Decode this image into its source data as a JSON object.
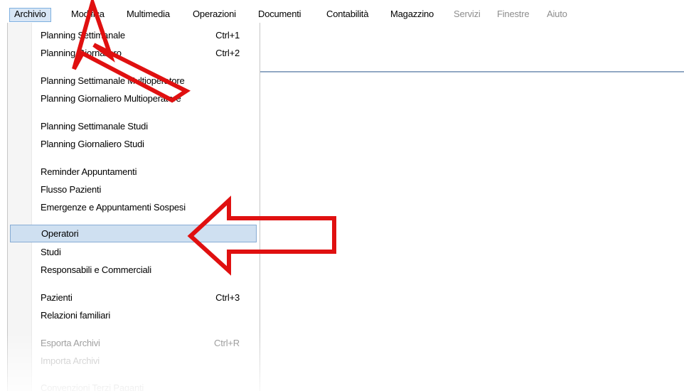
{
  "menubar": {
    "items": [
      {
        "label": "Archivio",
        "state": "active"
      },
      {
        "label": "Modifica",
        "state": "normal"
      },
      {
        "label": "Multimedia",
        "state": "normal"
      },
      {
        "label": "Operazioni",
        "state": "normal"
      },
      {
        "label": "Documenti",
        "state": "normal"
      },
      {
        "label": "Contabilità",
        "state": "normal"
      },
      {
        "label": "Magazzino",
        "state": "normal"
      },
      {
        "label": "Servizi",
        "state": "disabled"
      },
      {
        "label": "Finestre",
        "state": "disabled"
      },
      {
        "label": "Aiuto",
        "state": "disabled"
      }
    ]
  },
  "dropdown": {
    "items": [
      {
        "label": "Planning Settimanale",
        "shortcut": "Ctrl+1"
      },
      {
        "label": "Planning Giornaliero",
        "shortcut": "Ctrl+2"
      },
      {
        "label": "Planning Settimanale Multioperatore",
        "shortcut": ""
      },
      {
        "label": "Planning Giornaliero Multioperatore",
        "shortcut": ""
      },
      {
        "label": "Planning Settimanale Studi",
        "shortcut": ""
      },
      {
        "label": "Planning Giornaliero Studi",
        "shortcut": ""
      },
      {
        "label": "Reminder Appuntamenti",
        "shortcut": ""
      },
      {
        "label": "Flusso Pazienti",
        "shortcut": ""
      },
      {
        "label": "Emergenze e Appuntamenti Sospesi",
        "shortcut": ""
      },
      {
        "label": "Operatori",
        "shortcut": ""
      },
      {
        "label": "Studi",
        "shortcut": ""
      },
      {
        "label": "Responsabili e Commerciali",
        "shortcut": ""
      },
      {
        "label": "Pazienti",
        "shortcut": "Ctrl+3"
      },
      {
        "label": "Relazioni familiari",
        "shortcut": ""
      },
      {
        "label": "Esporta Archivi",
        "shortcut": "Ctrl+R"
      },
      {
        "label": "Importa Archivi",
        "shortcut": ""
      },
      {
        "label": "Convenzioni Terzi Paganti",
        "shortcut": ""
      }
    ]
  },
  "annotations": {
    "arrow_color": "#e01010",
    "arrow_icon": "red-pointer-arrow-icon"
  },
  "colors": {
    "menu_highlight": "#cfe0f1",
    "menu_highlight_border": "#87acd4",
    "disabled_text": "#8d8d8d"
  }
}
